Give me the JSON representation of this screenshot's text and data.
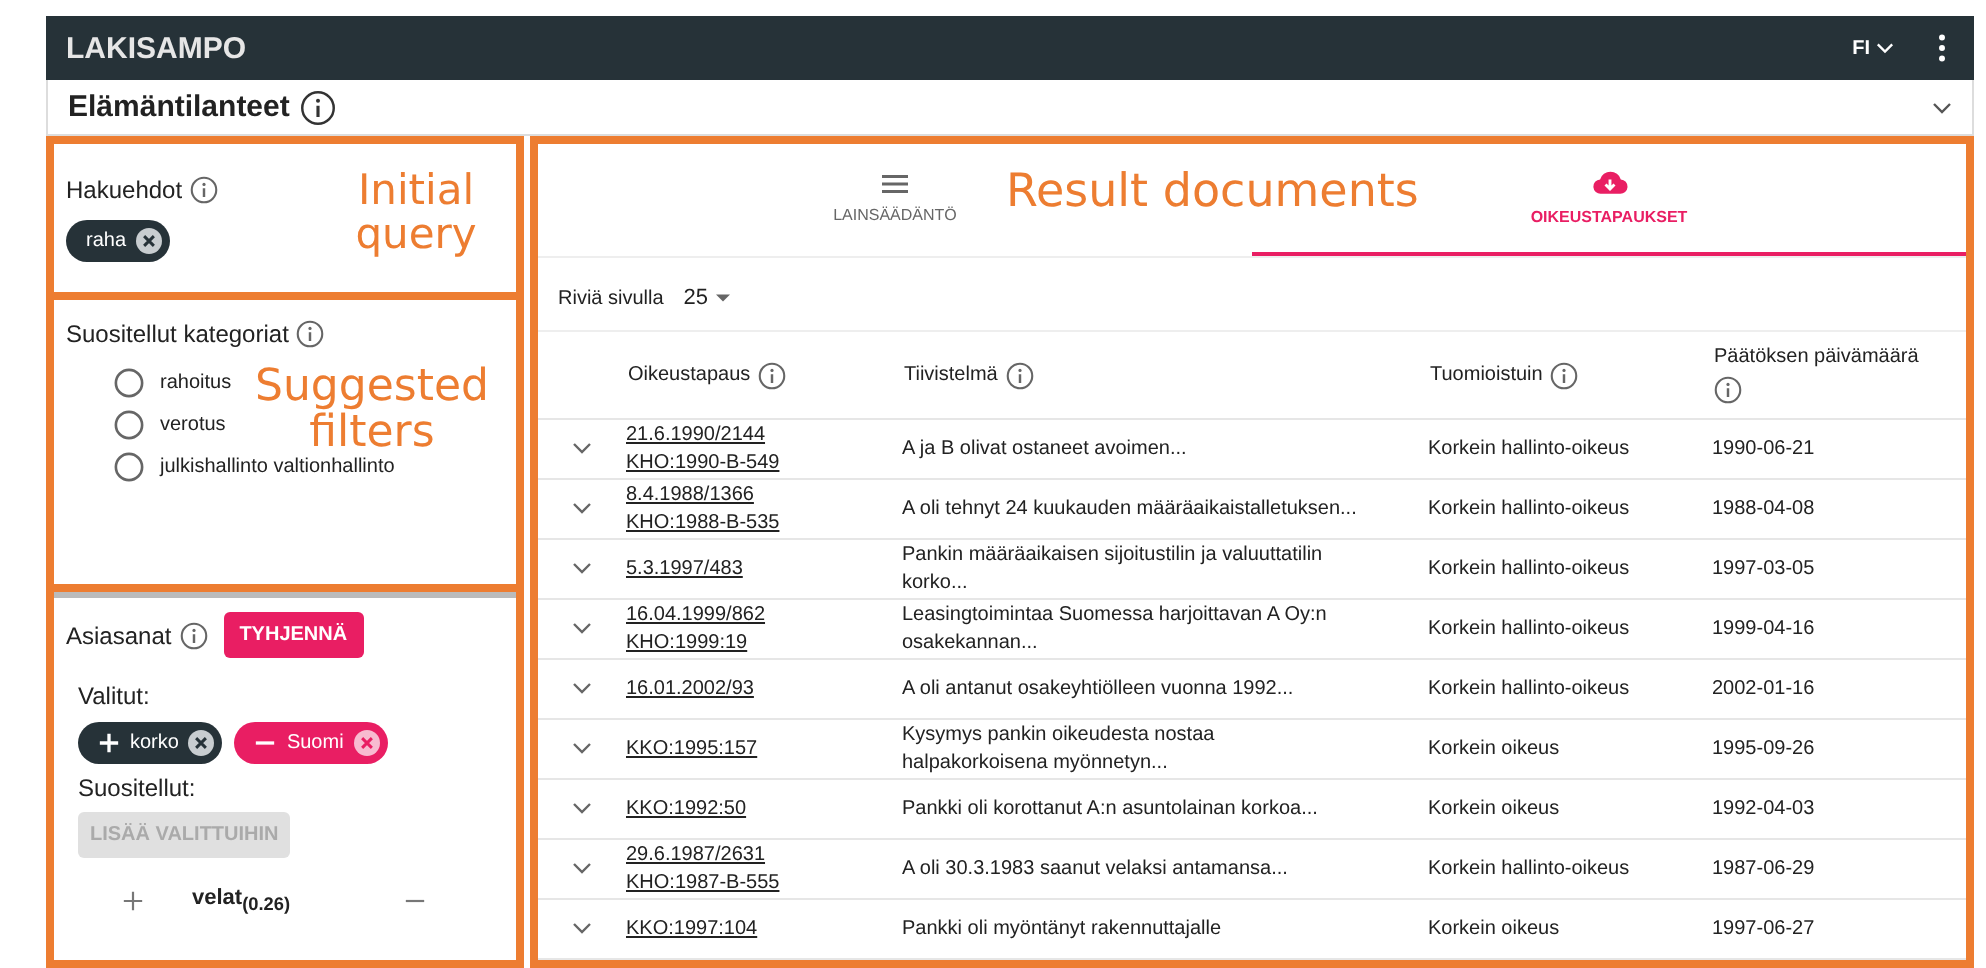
{
  "app_bar": {
    "title": "LAKISAMPO",
    "language": "FI"
  },
  "life_situations": {
    "label": "Elämäntilanteet"
  },
  "query": {
    "label": "Hakuehdot",
    "chips": [
      {
        "label": "raha"
      }
    ]
  },
  "categories": {
    "label": "Suositellut kategoriat",
    "items": [
      {
        "label": "rahoitus",
        "selected": false
      },
      {
        "label": "verotus",
        "selected": false
      },
      {
        "label": "julkishallinto valtionhallinto",
        "selected": false
      }
    ]
  },
  "keywords": {
    "label": "Asiasanat",
    "clear_button": "TYHJENNÄ",
    "selected_label": "Valitut:",
    "selected": [
      {
        "label": "korko",
        "kind": "include"
      },
      {
        "label": "Suomi",
        "kind": "exclude"
      }
    ],
    "suggested_label": "Suositellut:",
    "add_button": "LISÄÄ VALITTUIHIN",
    "suggested": [
      {
        "label": "velat$_{(0.26)}$"
      }
    ]
  },
  "tabs": [
    {
      "label": "LAINSÄÄDÄNTÖ",
      "kind": "list",
      "selected": false
    },
    {
      "label": "OIKEUSTAPAUKSET",
      "kind": "cloud",
      "selected": true
    }
  ],
  "rows_per_page": {
    "label": "Riviä sivulla",
    "value": "25"
  },
  "table": {
    "columns": [
      "Oikeustapaus",
      "Tiivistelmä",
      "Tuomioistuin",
      "Päätöksen päivämäärä"
    ],
    "rows": [
      {
        "cases": [
          "21.6.1990/2144",
          "KHO:1990-B-549"
        ],
        "summary": "A ja B olivat ostaneet avoimen...",
        "court": "Korkein hallinto-oikeus",
        "date": "1990-06-21"
      },
      {
        "cases": [
          "8.4.1988/1366",
          "KHO:1988-B-535"
        ],
        "summary": "A oli tehnyt 24 kuukauden määräaikaistalletuksen...",
        "court": "Korkein hallinto-oikeus",
        "date": "1988-04-08"
      },
      {
        "cases": [
          "5.3.1997/483"
        ],
        "summary": "Pankin määräaikaisen sijoitustilin ja valuuttatilin korko...",
        "court": "Korkein hallinto-oikeus",
        "date": "1997-03-05"
      },
      {
        "cases": [
          "16.04.1999/862",
          "KHO:1999:19"
        ],
        "summary": "Leasingtoimintaa Suomessa harjoittavan A Oy:n osakekannan...",
        "court": "Korkein hallinto-oikeus",
        "date": "1999-04-16"
      },
      {
        "cases": [
          "16.01.2002/93"
        ],
        "summary": "A oli antanut osakeyhtiölleen vuonna 1992...",
        "court": "Korkein hallinto-oikeus",
        "date": "2002-01-16"
      },
      {
        "cases": [
          "KKO:1995:157"
        ],
        "summary": "Kysymys pankin oikeudesta nostaa halpakorkoisena myönnetyn...",
        "court": "Korkein oikeus",
        "date": "1995-09-26"
      },
      {
        "cases": [
          "KKO:1992:50"
        ],
        "summary": "Pankki oli korottanut A:n asuntolainan korkoa...",
        "court": "Korkein oikeus",
        "date": "1992-04-03"
      },
      {
        "cases": [
          "29.6.1987/2631",
          "KHO:1987-B-555"
        ],
        "summary": "A oli 30.3.1983 saanut velaksi antamansa...",
        "court": "Korkein hallinto-oikeus",
        "date": "1987-06-29"
      },
      {
        "cases": [
          "KKO:1997:104"
        ],
        "summary": "Pankki oli myöntänyt rakennuttajalle",
        "court": "Korkein oikeus",
        "date": "1997-06-27"
      }
    ]
  },
  "annotations": [
    "Initial query",
    "Suggested filters",
    "Result documents"
  ]
}
